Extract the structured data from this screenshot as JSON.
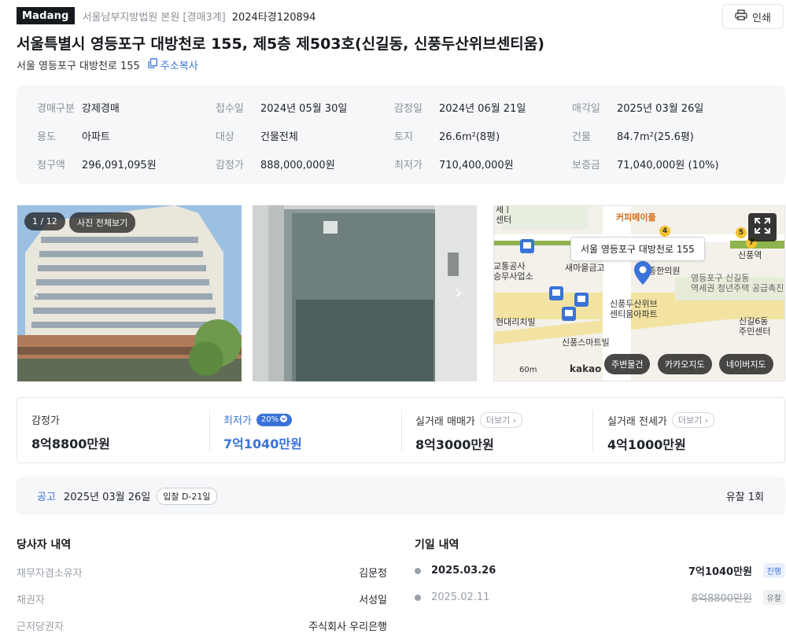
{
  "header": {
    "logo": "Madang",
    "court": "서울남부지방법원 본원 [경매3계]",
    "case_number": "2024타경120894",
    "print_label": "인쇄"
  },
  "title": "서울특별시 영등포구 대방천로 155, 제5층 제503호(신길동, 신풍두산위브센티움)",
  "address": {
    "short": "서울 영등포구 대방천로 155",
    "copy_label": "주소복사"
  },
  "info": [
    {
      "label": "경매구분",
      "value": "강제경매"
    },
    {
      "label": "접수일",
      "value": "2024년 05월 30일"
    },
    {
      "label": "감정일",
      "value": "2024년 06월 21일"
    },
    {
      "label": "매각일",
      "value": "2025년 03월 26일"
    },
    {
      "label": "용도",
      "value": "아파트"
    },
    {
      "label": "대상",
      "value": "건물전체"
    },
    {
      "label": "토지",
      "value": "26.6m²(8평)"
    },
    {
      "label": "건물",
      "value": "84.7m²(25.6평)"
    },
    {
      "label": "청구액",
      "value": "296,091,095원"
    },
    {
      "label": "감정가",
      "value": "888,000,000원"
    },
    {
      "label": "최저가",
      "value": "710,400,000원"
    },
    {
      "label": "보증금",
      "value": "71,040,000원 (10%)"
    }
  ],
  "photos": {
    "counter": "1 / 12",
    "view_all": "사진 전체보기",
    "prev_glyph": "‹",
    "next_glyph": "›"
  },
  "map": {
    "tooltip": "서울 영등포구 대방천로 155",
    "labels": {
      "coffee": "커피메이플",
      "bank": "새마을금고",
      "station": "신풍역",
      "clinic": "종한의원",
      "apt": "신풍두산위브\n센티움아파트",
      "youth": "영등포구 신길동\n역세권 청년주택 공급촉진지구",
      "villa": "현대리치빌",
      "mart": "신풍스마트빌",
      "center": "신길6동\n주민센터",
      "transit": "교통공사\n승무사업소",
      "scale": "60m",
      "brand": "kakao"
    },
    "buttons": [
      "주변물건",
      "카카오지도",
      "네이버지도"
    ],
    "line_numbers": [
      "4",
      "5",
      "7"
    ]
  },
  "prices": {
    "appraisal_label": "감정가",
    "appraisal_value": "8억8800만원",
    "minimum_label": "최저가",
    "minimum_pct": "20%",
    "minimum_value": "7억1040만원",
    "sale_label": "실거래 매매가",
    "sale_value": "8억3000만원",
    "lease_label": "실거래 전세가",
    "lease_value": "4억1000만원",
    "more_label": "더보기"
  },
  "notice": {
    "label": "공고",
    "date": "2025년 03월 26일",
    "dday": "입찰 D-21일",
    "fail_count": "유찰 1회"
  },
  "parties": {
    "title": "당사자 내역",
    "rows": [
      {
        "label": "채무자겸소유자",
        "value": "김문정"
      },
      {
        "label": "채권자",
        "value": "서성일"
      },
      {
        "label": "근저당권자",
        "value": "주식회사 우리은행"
      }
    ]
  },
  "dates": {
    "title": "기일 내역",
    "rows": [
      {
        "date": "2025.03.26",
        "price": "7억1040만원",
        "status": "진행"
      },
      {
        "date": "2025.02.11",
        "price": "8억8800만원",
        "status": "유찰"
      }
    ]
  },
  "colors": {
    "accent": "#3a73d9",
    "logo_bg": "#16191e",
    "info_bg": "#f6f7f9"
  }
}
